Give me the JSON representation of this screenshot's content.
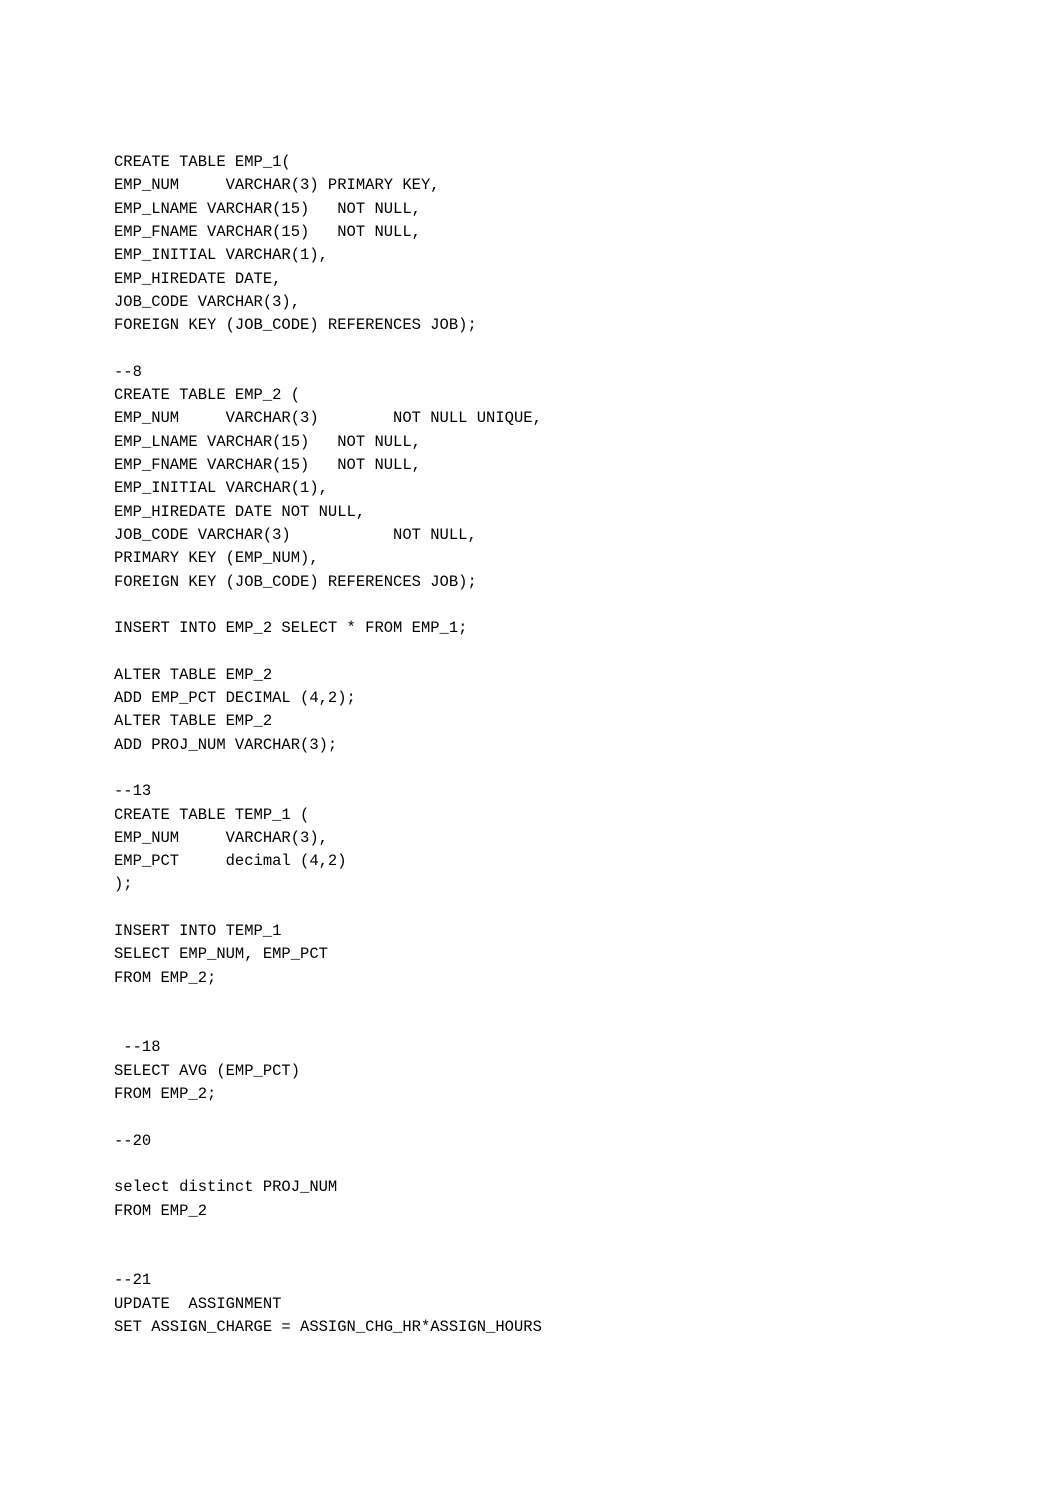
{
  "code": "CREATE TABLE EMP_1(\nEMP_NUM     VARCHAR(3) PRIMARY KEY,\nEMP_LNAME VARCHAR(15)   NOT NULL,\nEMP_FNAME VARCHAR(15)   NOT NULL,\nEMP_INITIAL VARCHAR(1),\nEMP_HIREDATE DATE,\nJOB_CODE VARCHAR(3),\nFOREIGN KEY (JOB_CODE) REFERENCES JOB);\n\n--8\nCREATE TABLE EMP_2 (\nEMP_NUM     VARCHAR(3)        NOT NULL UNIQUE,\nEMP_LNAME VARCHAR(15)   NOT NULL,\nEMP_FNAME VARCHAR(15)   NOT NULL,\nEMP_INITIAL VARCHAR(1),\nEMP_HIREDATE DATE NOT NULL,\nJOB_CODE VARCHAR(3)           NOT NULL,\nPRIMARY KEY (EMP_NUM),\nFOREIGN KEY (JOB_CODE) REFERENCES JOB);\n\nINSERT INTO EMP_2 SELECT * FROM EMP_1;\n\nALTER TABLE EMP_2\nADD EMP_PCT DECIMAL (4,2);\nALTER TABLE EMP_2\nADD PROJ_NUM VARCHAR(3);\n\n--13\nCREATE TABLE TEMP_1 (\nEMP_NUM     VARCHAR(3),\nEMP_PCT     decimal (4,2)\n);\n\nINSERT INTO TEMP_1\nSELECT EMP_NUM, EMP_PCT\nFROM EMP_2;\n\n\n --18\nSELECT AVG (EMP_PCT)\nFROM EMP_2;\n\n--20\n\nselect distinct PROJ_NUM\nFROM EMP_2\n\n\n--21\nUPDATE  ASSIGNMENT\nSET ASSIGN_CHARGE = ASSIGN_CHG_HR*ASSIGN_HOURS"
}
